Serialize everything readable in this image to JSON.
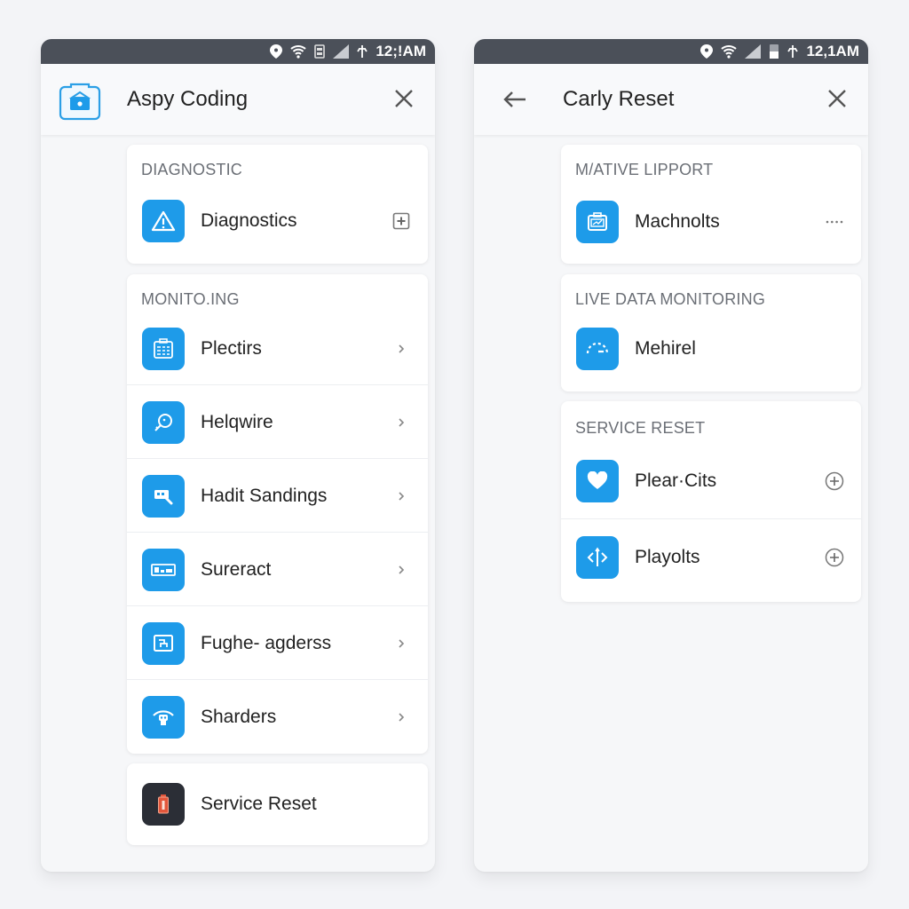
{
  "colors": {
    "accent": "#1e9be9",
    "statusbar": "#4b5059",
    "background": "#f3f4f7",
    "section_text": "#6b6f76"
  },
  "left_screen": {
    "status_bar": {
      "icons": [
        "location-icon",
        "wifi-icon",
        "sim-icon",
        "signal-icon",
        "data-icon"
      ],
      "time": "12;!AM"
    },
    "app_bar": {
      "logo_icon": "camera-lock-icon",
      "title": "Aspy Coding",
      "close_icon": "close-icon"
    },
    "sections": [
      {
        "title": "DIAGNOSTIC",
        "items": [
          {
            "label": "Diagnostics",
            "icon": "warning-icon",
            "trailing": "plus-square-icon"
          }
        ]
      },
      {
        "title": "MONITO.ING",
        "items": [
          {
            "label": "Plectirs",
            "icon": "clipboard-grid-icon",
            "trailing": "chevron-right-icon"
          },
          {
            "label": "Helqwire",
            "icon": "magnifier-icon",
            "trailing": "chevron-right-icon"
          },
          {
            "label": "Hadit Sandings",
            "icon": "search-card-icon",
            "trailing": "chevron-right-icon"
          },
          {
            "label": "Sureract",
            "icon": "display-panel-icon",
            "trailing": "chevron-right-icon"
          },
          {
            "label": "Fughe- agderss",
            "icon": "monitor-icon",
            "trailing": "chevron-right-icon"
          },
          {
            "label": "Sharders",
            "icon": "wifi-robot-icon",
            "trailing": "chevron-right-icon"
          }
        ]
      },
      {
        "title": "",
        "items": [
          {
            "label": "Service Reset",
            "icon": "battery-icon",
            "trailing": ""
          }
        ]
      }
    ]
  },
  "right_screen": {
    "status_bar": {
      "icons": [
        "location-icon",
        "wifi-icon",
        "signal-icon",
        "battery-icon",
        "data-icon"
      ],
      "time": "12,1AM"
    },
    "app_bar": {
      "back_icon": "arrow-left-icon",
      "title": "Carly Reset",
      "close_icon": "close-icon"
    },
    "sections": [
      {
        "title": "M/ATIVE LIPPORT",
        "items": [
          {
            "label": "Machnolts",
            "icon": "toolbox-icon",
            "trailing": "more-dots-icon"
          }
        ]
      },
      {
        "title": "LIVE DATA MONITORING",
        "items": [
          {
            "label": "Mehirel",
            "icon": "gauge-icon",
            "trailing": ""
          }
        ]
      },
      {
        "title": "SERVICE RESET",
        "items": [
          {
            "label": "Plear·Cits",
            "icon": "heart-icon",
            "trailing": "circle-plus-icon"
          },
          {
            "label": "Playolts",
            "icon": "code-icon",
            "trailing": "circle-plus-icon"
          }
        ]
      }
    ]
  }
}
